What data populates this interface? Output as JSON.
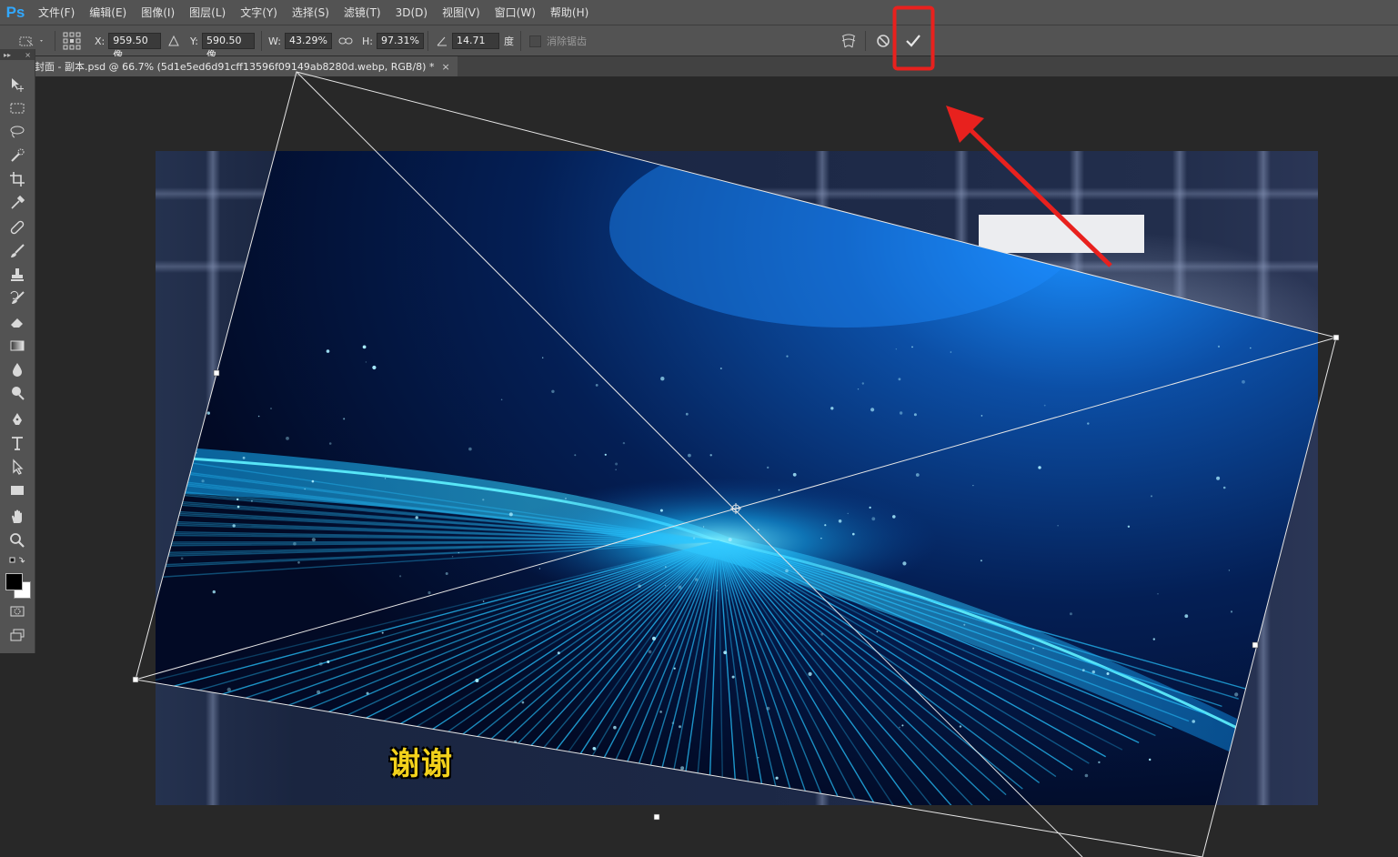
{
  "app": {
    "logo": "Ps"
  },
  "menu": [
    "文件(F)",
    "编辑(E)",
    "图像(I)",
    "图层(L)",
    "文字(Y)",
    "选择(S)",
    "滤镜(T)",
    "3D(D)",
    "视图(V)",
    "窗口(W)",
    "帮助(H)"
  ],
  "options": {
    "x_label": "X:",
    "x_value": "959.50 像",
    "y_label": "Y:",
    "y_value": "590.50 像",
    "w_label": "W:",
    "w_value": "43.29%",
    "h_label": "H:",
    "h_value": "97.31%",
    "angle_value": "14.71",
    "angle_unit": "度",
    "antialias_label": "消除锯齿"
  },
  "document_tab": {
    "title": "封面 - 副本.psd @ 66.7% (5d1e5ed6d91cff13596f09149ab8280d.webp, RGB/8) *",
    "close": "×"
  },
  "toolbar": {
    "collapse": "▸▸",
    "close": "×"
  },
  "canvas": {
    "bottom_text": "谢谢"
  },
  "colors": {
    "accent": "#31a8ff",
    "highlight": "#e8211e",
    "panel": "#535353",
    "workspace": "#282828"
  }
}
